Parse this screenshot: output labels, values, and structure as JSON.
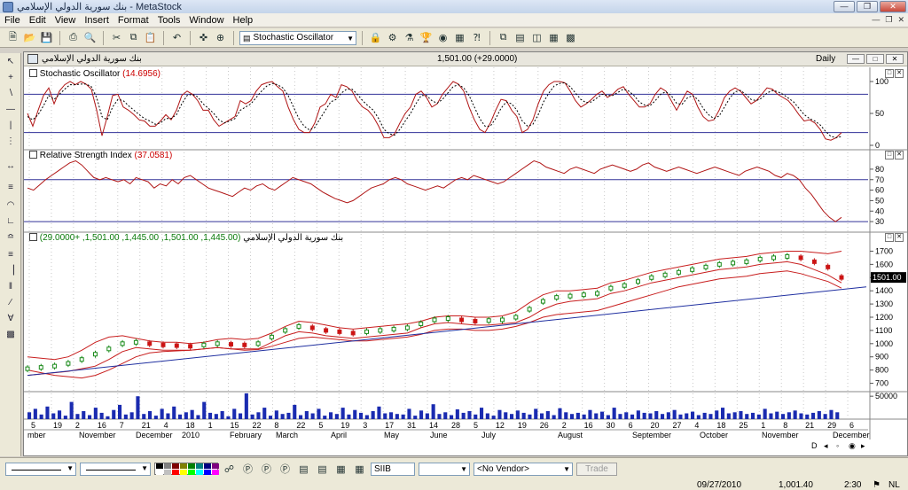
{
  "window": {
    "title": "بنك سورية الدولي الإسلامي - MetaStock"
  },
  "menu": [
    "File",
    "Edit",
    "View",
    "Insert",
    "Format",
    "Tools",
    "Window",
    "Help"
  ],
  "toolbar": {
    "indicator_select": "Stochastic Oscillator"
  },
  "chart_window": {
    "name": "بنك سورية الدولي الإسلامي",
    "price": "1,501.00 (+29.0000)",
    "period": "Daily"
  },
  "panels": {
    "stochastic": {
      "title": "Stochastic Oscillator",
      "value": "(14.6956)"
    },
    "rsi": {
      "title": "Relative Strength Index",
      "value": "(37.0581)"
    },
    "price": {
      "title": "بنك سورية الدولي الإسلامي",
      "value": "(1,445.00, 1,501.00, 1,445.00, 1,501.00, +29.0000)",
      "last_label": "1501.00"
    }
  },
  "statusbar": {
    "symbol": "SIIB",
    "vendor": "<No Vendor>",
    "trade": "Trade",
    "date": "09/27/2010",
    "value": "1,001.40",
    "time": "2:30",
    "lang": "NL"
  },
  "colors": {
    "stoch_line": "#b01515",
    "rsi_line": "#b01515",
    "price_band": "#c81e1e",
    "trend_line": "#1f2fa0",
    "volume": "#1a2bb0",
    "ref_line": "#333399"
  },
  "chart_data": [
    {
      "type": "line",
      "panel": "stochastic",
      "title": "Stochastic Oscillator",
      "series": [
        {
          "values": [
            50,
            30,
            55,
            78,
            90,
            65,
            85,
            95,
            100,
            95,
            100,
            96,
            88,
            55,
            15,
            45,
            78,
            80,
            60,
            55,
            48,
            40,
            38,
            30,
            30,
            38,
            48,
            40,
            55,
            78,
            85,
            80,
            70,
            55,
            55,
            40,
            30,
            35,
            40,
            45,
            70,
            65,
            70,
            85,
            95,
            98,
            100,
            92,
            85,
            60,
            40,
            25,
            20,
            20,
            35,
            60,
            65,
            80,
            75,
            95,
            92,
            85,
            70,
            60,
            55,
            45,
            30,
            12,
            12,
            18,
            35,
            50,
            60,
            80,
            85,
            75,
            60,
            65,
            80,
            90,
            100,
            96,
            85,
            60,
            40,
            25,
            20,
            35,
            55,
            72,
            70,
            55,
            45,
            20,
            25,
            40,
            65,
            85,
            95,
            100,
            100,
            98,
            85,
            70,
            60,
            65,
            72,
            80,
            85,
            75,
            80,
            88,
            92,
            80,
            70,
            60,
            60,
            65,
            80,
            90,
            85,
            70,
            55,
            70,
            85,
            80,
            60,
            45,
            38,
            40,
            55,
            75,
            85,
            90,
            85,
            75,
            65,
            70,
            80,
            90,
            88,
            80,
            75,
            70,
            60,
            48,
            38,
            40,
            35,
            25,
            10,
            8,
            12,
            20
          ]
        },
        {
          "values": [
            45,
            40,
            48,
            62,
            78,
            72,
            80,
            88,
            95,
            95,
            96,
            96,
            92,
            75,
            45,
            40,
            60,
            72,
            70,
            62,
            55,
            48,
            42,
            38,
            33,
            35,
            42,
            42,
            48,
            65,
            78,
            80,
            76,
            65,
            58,
            50,
            40,
            35,
            38,
            42,
            55,
            60,
            65,
            75,
            85,
            93,
            97,
            95,
            90,
            78,
            60,
            42,
            30,
            24,
            28,
            42,
            55,
            68,
            72,
            82,
            88,
            88,
            80,
            70,
            62,
            55,
            42,
            25,
            18,
            16,
            25,
            38,
            50,
            65,
            78,
            78,
            70,
            66,
            72,
            82,
            92,
            95,
            90,
            78,
            60,
            42,
            30,
            30,
            42,
            58,
            68,
            65,
            55,
            38,
            30,
            33,
            48,
            68,
            82,
            93,
            97,
            98,
            92,
            82,
            72,
            67,
            68,
            74,
            80,
            78,
            78,
            83,
            88,
            85,
            78,
            68,
            63,
            62,
            70,
            80,
            84,
            78,
            66,
            64,
            74,
            78,
            72,
            58,
            48,
            42,
            46,
            60,
            74,
            84,
            86,
            80,
            72,
            70,
            74,
            82,
            86,
            84,
            80,
            74,
            68,
            58,
            48,
            42,
            38,
            32,
            22,
            14,
            12,
            14
          ]
        }
      ],
      "y_ticks": [
        0,
        50,
        100
      ],
      "reference_lines": [
        20,
        80
      ]
    },
    {
      "type": "line",
      "panel": "rsi",
      "title": "Relative Strength Index",
      "series": [
        {
          "values": [
            62,
            60,
            65,
            70,
            74,
            78,
            82,
            86,
            88,
            84,
            78,
            72,
            70,
            72,
            70,
            68,
            70,
            66,
            72,
            70,
            68,
            62,
            66,
            64,
            70,
            66,
            72,
            74,
            70,
            66,
            62,
            60,
            58,
            56,
            54,
            58,
            62,
            60,
            64,
            66,
            62,
            60,
            64,
            68,
            72,
            70,
            68,
            66,
            62,
            58,
            55,
            52,
            50,
            48,
            50,
            54,
            58,
            62,
            64,
            66,
            70,
            72,
            70,
            66,
            64,
            62,
            60,
            62,
            64,
            62,
            66,
            70,
            72,
            70,
            74,
            72,
            70,
            68,
            66,
            68,
            72,
            76,
            80,
            84,
            88,
            86,
            82,
            80,
            78,
            76,
            80,
            82,
            80,
            78,
            76,
            80,
            82,
            84,
            82,
            80,
            78,
            80,
            84,
            86,
            82,
            80,
            78,
            80,
            82,
            80,
            78,
            76,
            78,
            80,
            82,
            80,
            78,
            76,
            74,
            78,
            80,
            82,
            80,
            78,
            74,
            72,
            76,
            74,
            70,
            62,
            56,
            48,
            40,
            34,
            30,
            34
          ]
        }
      ],
      "y_ticks": [
        30,
        40,
        50,
        60,
        70,
        80
      ],
      "reference_lines": [
        30,
        70
      ]
    },
    {
      "type": "line",
      "panel": "price",
      "title": "بنك سورية الدولي الإسلامي",
      "series": [
        {
          "values": [
            810,
            820,
            830,
            850,
            880,
            920,
            960,
            1000,
            1010,
            1000,
            990,
            985,
            980,
            990,
            1000,
            995,
            990,
            1000,
            1050,
            1100,
            1130,
            1120,
            1100,
            1090,
            1080,
            1090,
            1100,
            1110,
            1120,
            1150,
            1180,
            1190,
            1180,
            1170,
            1175,
            1180,
            1200,
            1260,
            1320,
            1350,
            1360,
            1370,
            1380,
            1420,
            1440,
            1470,
            1500,
            1520,
            1540,
            1560,
            1580,
            1600,
            1610,
            1620,
            1640,
            1650,
            1660,
            1650,
            1620,
            1580,
            1501
          ]
        },
        {
          "values": [
            900,
            890,
            880,
            900,
            950,
            1010,
            1050,
            1060,
            1040,
            1020,
            1010,
            1010,
            1000,
            1010,
            1030,
            1040,
            1030,
            1040,
            1080,
            1130,
            1170,
            1160,
            1140,
            1120,
            1110,
            1120,
            1130,
            1140,
            1150,
            1170,
            1200,
            1210,
            1210,
            1200,
            1200,
            1210,
            1240,
            1310,
            1370,
            1400,
            1400,
            1410,
            1420,
            1460,
            1480,
            1510,
            1540,
            1560,
            1580,
            1600,
            1620,
            1640,
            1650,
            1660,
            1680,
            1690,
            1700,
            1700,
            1690,
            1680,
            1700
          ]
        },
        {
          "values": [
            760,
            770,
            780,
            790,
            810,
            830,
            880,
            940,
            970,
            960,
            950,
            950,
            950,
            960,
            970,
            960,
            960,
            960,
            1010,
            1060,
            1090,
            1080,
            1060,
            1050,
            1040,
            1050,
            1060,
            1070,
            1080,
            1120,
            1150,
            1160,
            1150,
            1140,
            1140,
            1150,
            1160,
            1200,
            1260,
            1300,
            1320,
            1330,
            1340,
            1380,
            1400,
            1430,
            1460,
            1480,
            1500,
            1520,
            1540,
            1560,
            1570,
            1580,
            1600,
            1610,
            1620,
            1600,
            1560,
            1520,
            1460
          ]
        },
        {
          "values": [
            800,
            780,
            760,
            750,
            740,
            760,
            800,
            850,
            900,
            930,
            940,
            945,
            950,
            960,
            970,
            960,
            950,
            955,
            980,
            1010,
            1040,
            1050,
            1040,
            1030,
            1020,
            1020,
            1030,
            1040,
            1050,
            1070,
            1100,
            1110,
            1110,
            1100,
            1100,
            1110,
            1130,
            1160,
            1200,
            1220,
            1230,
            1240,
            1250,
            1280,
            1310,
            1340,
            1370,
            1400,
            1430,
            1450,
            1470,
            1490,
            1500,
            1510,
            1530,
            1540,
            1550,
            1530,
            1500,
            1470,
            1420
          ]
        },
        {
          "values": [
            730,
            740,
            750,
            760,
            770,
            780,
            790,
            800,
            810,
            820,
            830,
            840,
            850,
            860,
            870,
            880,
            890,
            900,
            910,
            920,
            930,
            940,
            950,
            960,
            970,
            980,
            990,
            1000,
            1010,
            1020,
            1030,
            1040,
            1050,
            1060,
            1070,
            1080,
            1090,
            1100,
            1110,
            1120,
            1130,
            1140,
            1150,
            1160,
            1170,
            1180,
            1190,
            1200,
            1210,
            1220,
            1230,
            1240,
            1250,
            1260,
            1270,
            1280,
            1290,
            1300,
            1310,
            1320,
            1330
          ]
        }
      ],
      "y_ticks": [
        700,
        800,
        900,
        1000,
        1100,
        1200,
        1300,
        1400,
        1500,
        1600,
        1700
      ]
    },
    {
      "type": "bar",
      "panel": "volume",
      "y_ticks": [
        50000
      ],
      "values": [
        12,
        18,
        8,
        22,
        10,
        15,
        6,
        30,
        9,
        14,
        7,
        20,
        11,
        5,
        16,
        25,
        8,
        12,
        40,
        9,
        14,
        6,
        18,
        10,
        22,
        8,
        12,
        16,
        7,
        30,
        11,
        9,
        14,
        5,
        18,
        10,
        45,
        8,
        12,
        20,
        6,
        15,
        9,
        11,
        25,
        7,
        14,
        10,
        18,
        6,
        12,
        9,
        20,
        8,
        16,
        11,
        7,
        14,
        22,
        10,
        12,
        9,
        8,
        18,
        6,
        15,
        10,
        26,
        9,
        12,
        7,
        17,
        11,
        14,
        8,
        20,
        10,
        6,
        16,
        12,
        9,
        15,
        11,
        8,
        18,
        10,
        14,
        7,
        19,
        12,
        9,
        11,
        8,
        16,
        10,
        13,
        7,
        20,
        9,
        12,
        8,
        15,
        11,
        10,
        14,
        9,
        12,
        16,
        8,
        10,
        13,
        7,
        11,
        9,
        15,
        20,
        10,
        12,
        14,
        9,
        11,
        8,
        18,
        10,
        13,
        9,
        12,
        15,
        10,
        8,
        11,
        14,
        9,
        16,
        12
      ]
    }
  ],
  "x_axis": {
    "days": [
      "5",
      "19",
      "2",
      "16",
      "7",
      "21",
      "4",
      "18",
      "1",
      "15",
      "22",
      "8",
      "22",
      "5",
      "19",
      "3",
      "17",
      "31",
      "14",
      "28",
      "5",
      "12",
      "19",
      "26",
      "2",
      "16",
      "30",
      "6",
      "20",
      "27",
      "4",
      "18",
      "25",
      "1",
      "8",
      "21",
      "29",
      "6"
    ],
    "months": [
      "mber",
      "November",
      "December",
      "2010",
      "February",
      "March",
      "April",
      "May",
      "June",
      "July",
      "August",
      "September",
      "October",
      "November",
      "December"
    ]
  }
}
